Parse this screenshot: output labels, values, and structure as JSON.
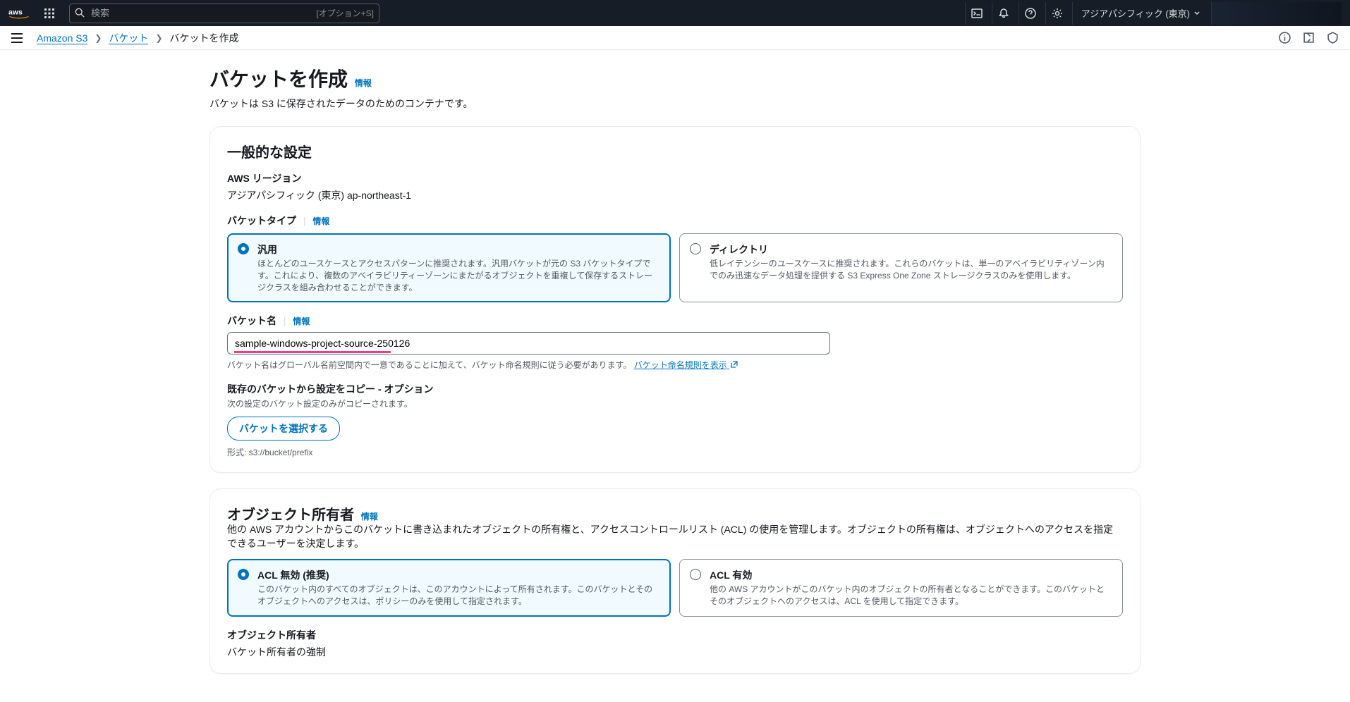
{
  "topnav": {
    "search_placeholder": "検索",
    "search_hint": "[オプション+S]",
    "region": "アジアパシフィック (東京)"
  },
  "breadcrumb": {
    "items": [
      "Amazon S3",
      "バケット",
      "バケットを作成"
    ]
  },
  "page": {
    "title": "バケットを作成",
    "info": "情報",
    "description": "バケットは S3 に保存されたデータのためのコンテナです。"
  },
  "general": {
    "heading": "一般的な設定",
    "region_label": "AWS リージョン",
    "region_value": "アジアパシフィック (東京) ap-northeast-1",
    "bucket_type_label": "バケットタイプ",
    "info": "情報",
    "type_options": [
      {
        "title": "汎用",
        "desc": "ほとんどのユースケースとアクセスパターンに推奨されます。汎用バケットが元の S3 バケットタイプです。これにより、複数のアベイラビリティーゾーンにまたがるオブジェクトを重複して保存するストレージクラスを組み合わせることができます。",
        "selected": true
      },
      {
        "title": "ディレクトリ",
        "desc": "低レイテンシーのユースケースに推奨されます。これらのバケットは、単一のアベイラビリティゾーン内でのみ迅速なデータ処理を提供する S3 Express One Zone ストレージクラスのみを使用します。",
        "selected": false
      }
    ],
    "bucket_name_label": "バケット名",
    "bucket_name_value": "sample-windows-project-source-250126",
    "bucket_name_hint_prefix": "バケット名はグローバル名前空間内で一意であることに加えて、バケット命名規則に従う必要があります。",
    "bucket_name_link": "バケット命名規則を表示",
    "copy_heading": "既存のバケットから設定をコピー - オプション",
    "copy_desc": "次の設定のバケット設定のみがコピーされます。",
    "choose_bucket_btn": "バケットを選択する",
    "format_hint": "形式: s3://bucket/prefix"
  },
  "ownership": {
    "heading": "オブジェクト所有者",
    "info": "情報",
    "desc": "他の AWS アカウントからこのバケットに書き込まれたオブジェクトの所有権と、アクセスコントロールリスト (ACL) の使用を管理します。オブジェクトの所有権は、オブジェクトへのアクセスを指定できるユーザーを決定します。",
    "options": [
      {
        "title": "ACL 無効 (推奨)",
        "desc": "このバケット内のすべてのオブジェクトは、このアカウントによって所有されます。このバケットとそのオブジェクトへのアクセスは、ポリシーのみを使用して指定されます。",
        "selected": true
      },
      {
        "title": "ACL 有効",
        "desc": "他の AWS アカウントがこのバケット内のオブジェクトの所有者となることができます。このバケットとそのオブジェクトへのアクセスは、ACL を使用して指定できます。",
        "selected": false
      }
    ],
    "owner_heading": "オブジェクト所有者",
    "owner_value": "バケット所有者の強制"
  }
}
